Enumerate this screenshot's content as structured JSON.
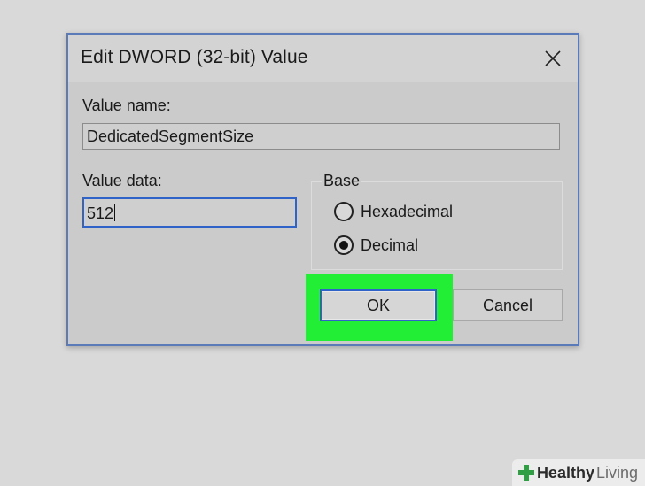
{
  "dialog": {
    "title": "Edit DWORD (32-bit) Value",
    "value_name_label": "Value name:",
    "value_name": "DedicatedSegmentSize",
    "value_data_label": "Value data:",
    "value_data": "512",
    "base": {
      "legend": "Base",
      "options": [
        {
          "label": "Hexadecimal",
          "checked": false
        },
        {
          "label": "Decimal",
          "checked": true
        }
      ]
    },
    "buttons": {
      "ok": "OK",
      "cancel": "Cancel"
    }
  },
  "colors": {
    "highlight": "#22ee36",
    "focus_border": "#2f63c8",
    "watermark_icon": "#2ea043"
  },
  "watermark": {
    "brand_first": "Healthy",
    "brand_second": "Living"
  }
}
